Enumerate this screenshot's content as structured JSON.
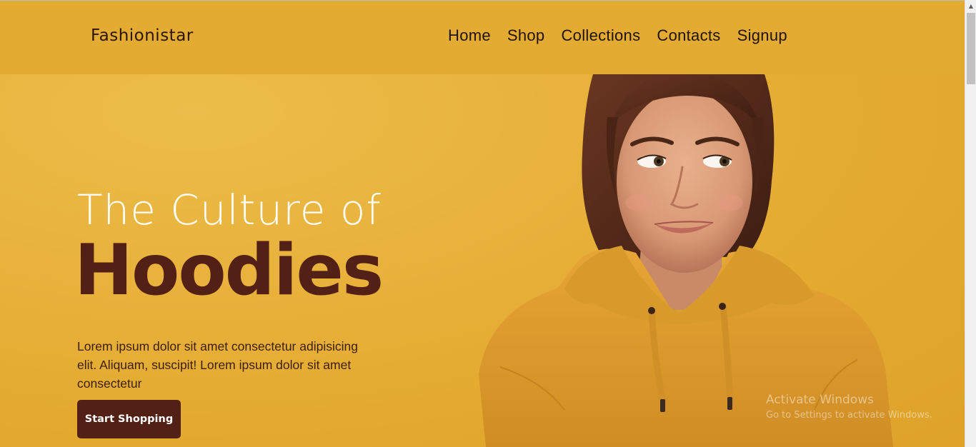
{
  "header": {
    "logo": "Fashionistar",
    "nav": [
      "Home",
      "Shop",
      "Collections",
      "Contacts",
      "Signup"
    ]
  },
  "hero": {
    "headline_light": "The Culture of",
    "headline_bold": "Hoodies",
    "blurb": "Lorem ipsum dolor sit amet consectetur adipisicing elit. Aliquam, suscipit! Lorem ipsum dolor sit amet consectetur",
    "cta_label": "Start Shopping"
  },
  "watermark": {
    "title": "Activate Windows",
    "subtitle": "Go to Settings to activate Windows."
  },
  "colors": {
    "background": "#e3ab32",
    "accent_dark": "#532015",
    "headline_light": "#ffffff"
  },
  "icons": {
    "scroll_up": "chevron-up-icon"
  }
}
